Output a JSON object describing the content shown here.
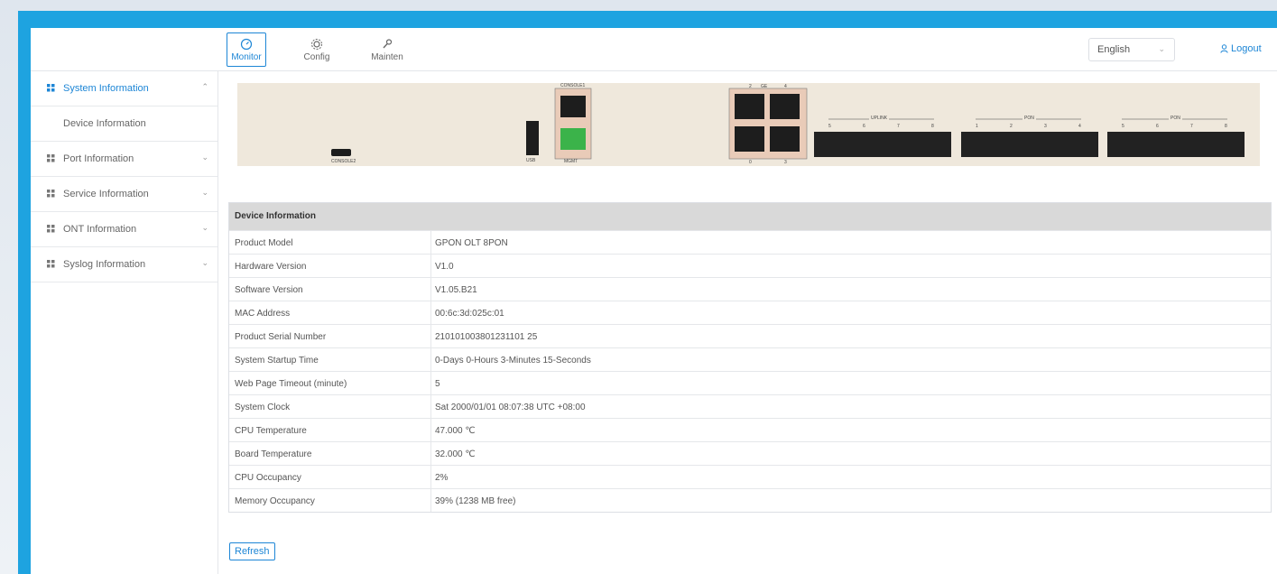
{
  "topnav": [
    {
      "label": "Monitor",
      "icon": "monitor-icon",
      "active": true
    },
    {
      "label": "Config",
      "icon": "gear-icon",
      "active": false
    },
    {
      "label": "Mainten",
      "icon": "wrench-icon",
      "active": false
    }
  ],
  "language": {
    "selected": "English"
  },
  "logout_label": "Logout",
  "sidebar": {
    "items": [
      {
        "label": "System Information",
        "active": true
      },
      {
        "label": "Device Information"
      },
      {
        "label": "Port Information"
      },
      {
        "label": "Service Information"
      },
      {
        "label": "ONT Information"
      },
      {
        "label": "Syslog Information"
      }
    ]
  },
  "device_panel": {
    "labels": {
      "console": "CONSOLE1",
      "usb": "USB",
      "mgmt": "MGMT",
      "console2": "CONSOLE2",
      "uplink": "UPLINK",
      "pon_a": "PON",
      "pon_b": "PON",
      "ge": "GE"
    },
    "port_numbers_a": [
      "1",
      "2",
      "3",
      "4"
    ],
    "port_numbers_b": [
      "1",
      "2",
      "3",
      "4"
    ],
    "port_numbers_c": [
      "5",
      "6",
      "7",
      "8"
    ],
    "uplink_numbers": [
      "5",
      "6",
      "7",
      "8"
    ],
    "ge_top": [
      "2",
      "4"
    ],
    "ge_bottom": [
      "0",
      "3"
    ]
  },
  "device_info": {
    "title": "Device Information",
    "rows": [
      {
        "k": "Product Model",
        "v": "GPON OLT 8PON"
      },
      {
        "k": "Hardware Version",
        "v": "V1.0"
      },
      {
        "k": "Software Version",
        "v": "V1.05.B21"
      },
      {
        "k": "MAC Address",
        "v": "00:6c:3d:025c:01"
      },
      {
        "k": "Product Serial Number",
        "v": "210101003801231101 25"
      },
      {
        "k": "System Startup Time",
        "v": "0-Days 0-Hours 3-Minutes 15-Seconds"
      },
      {
        "k": "Web Page Timeout (minute)",
        "v": "5"
      },
      {
        "k": "System Clock",
        "v": "Sat 2000/01/01 08:07:38 UTC +08:00"
      },
      {
        "k": "CPU Temperature",
        "v": "47.000 ℃"
      },
      {
        "k": "Board Temperature",
        "v": "32.000 ℃"
      },
      {
        "k": "CPU Occupancy",
        "v": "2%"
      },
      {
        "k": "Memory Occupancy",
        "v": "39% (1238 MB free)"
      }
    ]
  },
  "refresh_label": "Refresh",
  "colors": {
    "accent": "#1d86d6",
    "frame": "#1ea3e0",
    "panel": "#efe8dc",
    "mgmt_port": "#3bb34a"
  }
}
